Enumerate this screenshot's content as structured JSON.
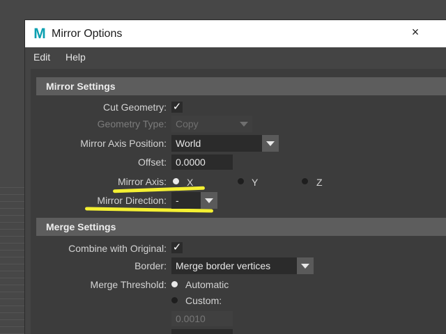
{
  "window": {
    "app_icon_letter": "M",
    "title": "Mirror Options"
  },
  "menu": {
    "items": [
      "Edit",
      "Help"
    ]
  },
  "mirror_settings": {
    "header": "Mirror Settings",
    "cut_geometry": {
      "label": "Cut Geometry:",
      "checked": true
    },
    "geometry_type": {
      "label": "Geometry Type:",
      "value": "Copy",
      "enabled": false
    },
    "mirror_axis_position": {
      "label": "Mirror Axis Position:",
      "value": "World"
    },
    "offset": {
      "label": "Offset:",
      "value": "0.0000"
    },
    "mirror_axis": {
      "label": "Mirror Axis:",
      "options": [
        "X",
        "Y",
        "Z"
      ],
      "selected": "X"
    },
    "mirror_direction": {
      "label": "Mirror Direction:",
      "value": "-"
    }
  },
  "merge_settings": {
    "header": "Merge Settings",
    "combine_with_original": {
      "label": "Combine with Original:",
      "checked": true
    },
    "border": {
      "label": "Border:",
      "value": "Merge border vertices"
    },
    "merge_threshold": {
      "label": "Merge Threshold:",
      "options": [
        "Automatic",
        "Custom:"
      ],
      "selected": "Automatic",
      "custom_value": "0.0010"
    }
  },
  "colors": {
    "annotation_highlight": "#f4f032",
    "app_icon": "#0a9fb0"
  },
  "icons": {
    "checkmark": "check-icon",
    "dropdown_arrow": "chevron-down-icon",
    "close": "close-icon"
  }
}
